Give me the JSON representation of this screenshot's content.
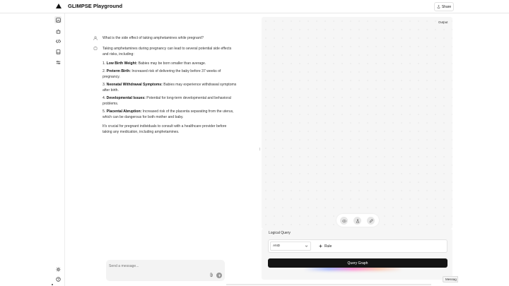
{
  "app": {
    "title": "GLIMPSE Playground",
    "share_label": "Share"
  },
  "sidebar": {
    "items": [
      {
        "icon": "gallery-icon",
        "active": true
      },
      {
        "icon": "robot-icon",
        "active": false
      },
      {
        "icon": "code-icon",
        "active": false
      },
      {
        "icon": "book-icon",
        "active": false
      },
      {
        "icon": "sliders-icon",
        "active": false
      }
    ],
    "bottom": [
      {
        "icon": "sun-icon"
      },
      {
        "icon": "help-icon"
      }
    ]
  },
  "chat": {
    "question": "What is the side effect of taking amphetamines while pregnant?",
    "answer_intro": "Taking amphetamines during pregnancy can lead to several potential side effects and risks, including:",
    "points": [
      {
        "num": "1.",
        "title": "Low Birth Weight:",
        "text": "Babies may be born smaller than average."
      },
      {
        "num": "2.",
        "title": "Preterm Birth:",
        "text": "Increased risk of delivering the baby before 37 weeks of pregnancy."
      },
      {
        "num": "3.",
        "title": "Neonatal Withdrawal Symptoms:",
        "text": "Babies may experience withdrawal symptoms after birth."
      },
      {
        "num": "4.",
        "title": "Developmental Issues:",
        "text": "Potential for long-term developmental and behavioral problems."
      },
      {
        "num": "5.",
        "title": "Placental Abruption:",
        "text": "Increased risk of the placenta separating from the uterus, which can be dangerous for both mother and baby."
      }
    ],
    "answer_outro": "It's crucial for pregnant individuals to consult with a healthcare provider before taking any medication, including amphetamines.",
    "composer_placeholder": "Send a message..."
  },
  "output": {
    "label": "Output"
  },
  "query": {
    "label": "Logical Query",
    "operator": "AND",
    "rule_label": "Rule",
    "button_label": "Query Graph"
  },
  "footer": {
    "message_tab": "Messag"
  }
}
